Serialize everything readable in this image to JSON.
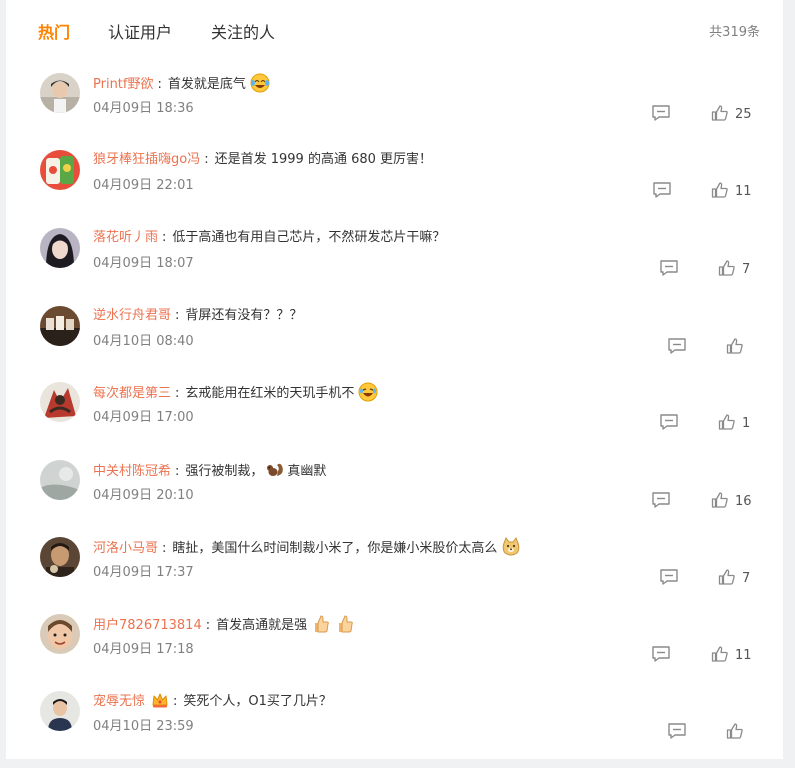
{
  "tabs": {
    "hot": "热门",
    "verified": "认证用户",
    "following": "关注的人"
  },
  "total": "共319条",
  "comments": [
    {
      "user": "Printf野欲",
      "text": "首发就是底气",
      "emoji": "laugh-cry-emoji",
      "time": "04月09日 18:36",
      "likes": "25"
    },
    {
      "user": "狼牙棒狂插嗨go冯",
      "text": "还是首发 1999 的高通 680 更厉害！",
      "time": "04月09日 22:01",
      "likes": "11"
    },
    {
      "user": "落花听丿雨",
      "text": "低于高通也有用自己芯片，不然研发芯片干嘛？",
      "time": "04月09日 18:07",
      "likes": "7"
    },
    {
      "user": "逆水行舟君哥",
      "text": "背屏还有没有？？？",
      "time": "04月10日 08:40",
      "likes": ""
    },
    {
      "user": "每次都是第三",
      "text": "玄戒能用在红米的天玑手机不",
      "emoji": "laugh-emoji",
      "time": "04月09日 17:00",
      "likes": "1"
    },
    {
      "user": "中关村陈冠希",
      "text": "强行被制裁，",
      "text2": "真幽默",
      "emoji": "squirrel-emoji",
      "time": "04月09日 20:10",
      "likes": "16"
    },
    {
      "user": "河洛小马哥",
      "text": "瞎扯，美国什么时间制裁小米了，你是嫌小米股价太高么",
      "emoji": "doge-emoji",
      "time": "04月09日 17:37",
      "likes": "7"
    },
    {
      "user": "用户7826713814",
      "text": "首发高通就是强",
      "emoji": "thumbs-up-emoji",
      "time": "04月09日 17:18",
      "likes": "11"
    },
    {
      "user": "宠辱无惊",
      "text": "笑死个人，O1买了几片？",
      "badge": "crown-icon",
      "time": "04月10日 23:59",
      "likes": ""
    }
  ],
  "colors": {
    "accent": "#ff8200",
    "username": "#eb7350",
    "muted": "#808080"
  }
}
